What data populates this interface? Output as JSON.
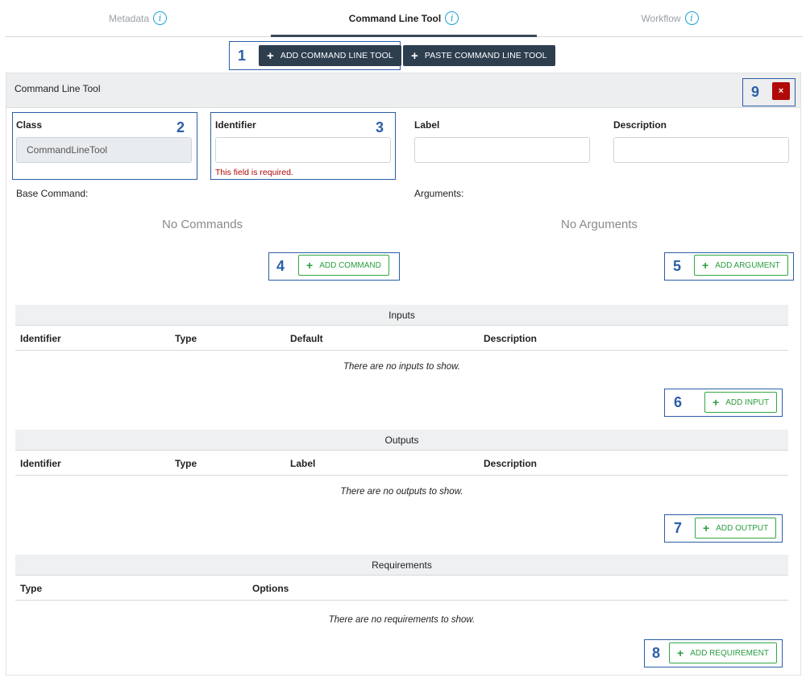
{
  "tabs": [
    {
      "label": "Metadata",
      "active": false
    },
    {
      "label": "Command Line Tool",
      "active": true
    },
    {
      "label": "Workflow",
      "active": false
    }
  ],
  "toolbar": {
    "add_tool_label": "ADD COMMAND LINE TOOL",
    "paste_tool_label": "PASTE COMMAND LINE TOOL"
  },
  "panel": {
    "title": "Command Line Tool",
    "close_glyph": "×"
  },
  "fields": {
    "class_label": "Class",
    "class_value": "CommandLineTool",
    "identifier_label": "Identifier",
    "identifier_value": "",
    "identifier_error": "This field is required.",
    "label_label": "Label",
    "label_value": "",
    "description_label": "Description",
    "description_value": ""
  },
  "commands": {
    "base_label": "Base Command:",
    "empty": "No Commands",
    "add_label": "ADD COMMAND"
  },
  "arguments": {
    "label": "Arguments:",
    "empty": "No Arguments",
    "add_label": "ADD ARGUMENT"
  },
  "inputs": {
    "title": "Inputs",
    "columns": [
      "Identifier",
      "Type",
      "Default",
      "Description"
    ],
    "empty": "There are no inputs to show.",
    "add_label": "ADD INPUT"
  },
  "outputs": {
    "title": "Outputs",
    "columns": [
      "Identifier",
      "Type",
      "Label",
      "Description"
    ],
    "empty": "There are no outputs to show.",
    "add_label": "ADD OUTPUT"
  },
  "requirements": {
    "title": "Requirements",
    "columns": [
      "Type",
      "Options"
    ],
    "empty": "There are no requirements to show.",
    "add_label": "ADD REQUIREMENT"
  },
  "annotations": [
    "1",
    "2",
    "3",
    "4",
    "5",
    "6",
    "7",
    "8",
    "9"
  ],
  "icons": {
    "info": "i",
    "plus": "+"
  },
  "colors": {
    "accent_dark": "#2d3e4f",
    "success": "#32a845",
    "danger": "#b00a0a",
    "info": "#1aa3d6",
    "annotation": "#2b5ea8"
  }
}
